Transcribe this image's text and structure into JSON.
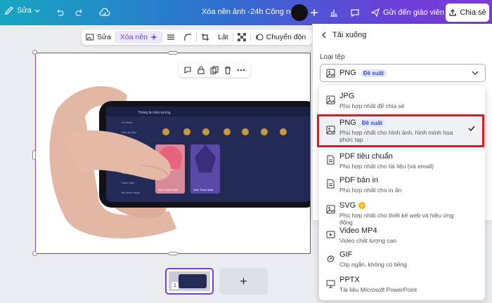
{
  "topbar": {
    "edit_label": "Sửa",
    "doc_title": "Xóa nền ảnh -24h Công nghệ",
    "send_label": "Gửi đến giáo viên",
    "share_label": "Chia sẻ"
  },
  "ctx": {
    "edit_label": "Sửa",
    "remove_bg_label": "Xóa nền",
    "flip_label": "Lật",
    "animate_label": "Chuyển độn"
  },
  "panel": {
    "title": "Tải xuống",
    "file_type_label": "Loại tệp",
    "selected_value": "PNG",
    "selected_badge": "Đề xuất"
  },
  "options": [
    {
      "title": "JPG",
      "desc": "Phù hợp nhất để chia sẻ",
      "icon": "image-icon"
    },
    {
      "title": "PNG",
      "badge": "Đề xuất",
      "desc": "Phù hợp nhất cho hình ảnh, hình minh họa phức tạp",
      "icon": "image-icon"
    },
    {
      "title": "PDF tiêu chuẩn",
      "desc": "Phù hợp nhất cho tài liệu (và email)",
      "icon": "document-icon"
    },
    {
      "title": "PDF bản in",
      "desc": "Phù hợp nhất cho in ấn",
      "icon": "document-icon"
    },
    {
      "title": "SVG",
      "desc": "Phù hợp nhất cho thiết kế web và hiệu ứng động",
      "icon": "image-icon"
    },
    {
      "title": "Video MP4",
      "desc": "Video chất lượng cao",
      "icon": "video-icon"
    },
    {
      "title": "GIF",
      "desc": "Clip ngắn, không có tiếng",
      "icon": "gif-icon"
    },
    {
      "title": "PPTX",
      "desc": "Tài liệu Microsoft PowerPoint",
      "icon": "presentation-icon"
    }
  ],
  "game": {
    "header": "Thông tin kiện tướng",
    "menu": [
      "Cá Nhân",
      "Lịch sử đấu",
      "Thống kê",
      "Xã Hội",
      "Lưu chiêu",
      "Huy hiệu",
      "Danh hiệu",
      "Bộ chiến thuật"
    ],
    "card1": "Bình Thuận Nhấn",
    "card2": "Bình Thuận Nhấn"
  },
  "page_strip": {
    "page_number": "1",
    "add_label": "+"
  },
  "colors": {
    "accent": "#7d3bd6",
    "highlight": "#e4161d",
    "badge": "#3a45d6"
  }
}
